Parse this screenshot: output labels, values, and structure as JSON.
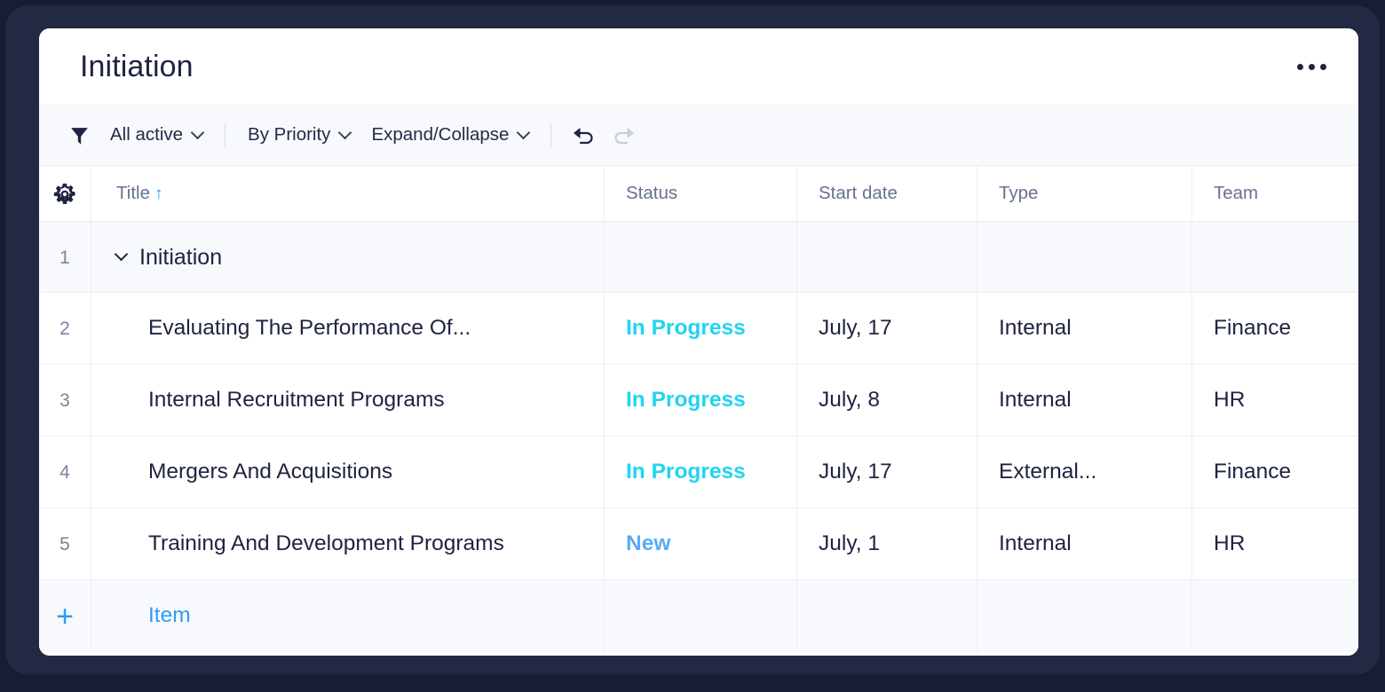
{
  "window": {
    "title": "Initiation",
    "more_menu": "more-options"
  },
  "toolbar": {
    "filter_icon": "filter-funnel-icon",
    "filter_label": "All active",
    "group_label": "By Priority",
    "expand_label": "Expand/Collapse",
    "undo_icon": "undo-arrow-icon",
    "redo_icon": "redo-arrow-icon"
  },
  "grid": {
    "settings_icon": "gear-icon",
    "columns": [
      {
        "key": "title",
        "label": "Title",
        "sorted": true,
        "sort_arrow": "↑"
      },
      {
        "key": "status",
        "label": "Status",
        "sorted": false
      },
      {
        "key": "start",
        "label": "Start date",
        "sorted": false
      },
      {
        "key": "type",
        "label": "Type",
        "sorted": false
      },
      {
        "key": "team",
        "label": "Team",
        "sorted": false
      }
    ],
    "group_row": {
      "number": "1",
      "title": "Initiation",
      "expanded": true
    },
    "rows": [
      {
        "number": "2",
        "title": "Evaluating The Performance Of...",
        "status": "In Progress",
        "status_color": "#21d4f0",
        "start": "July, 17",
        "type": "Internal",
        "team": "Finance"
      },
      {
        "number": "3",
        "title": "Internal Recruitment Programs",
        "status": "In Progress",
        "status_color": "#21d4f0",
        "start": "July, 8",
        "type": "Internal",
        "team": "HR"
      },
      {
        "number": "4",
        "title": "Mergers And Acquisitions",
        "status": "In Progress",
        "status_color": "#21d4f0",
        "start": "July, 17",
        "type": "External...",
        "team": "Finance"
      },
      {
        "number": "5",
        "title": "Training And Development Programs",
        "status": "New",
        "status_color": "#5aaaf5",
        "start": "July, 1",
        "type": "Internal",
        "team": "HR"
      }
    ],
    "add_row": {
      "plus": "+",
      "label": "Item"
    }
  },
  "colors": {
    "frame": "#232943",
    "accent_blue": "#2e9cf5",
    "status_in_progress": "#21d4f0",
    "status_new": "#5aaaf5",
    "text_dark": "#1e2340",
    "text_muted": "#67718f",
    "toolbar_bg": "#f7f9fc"
  }
}
